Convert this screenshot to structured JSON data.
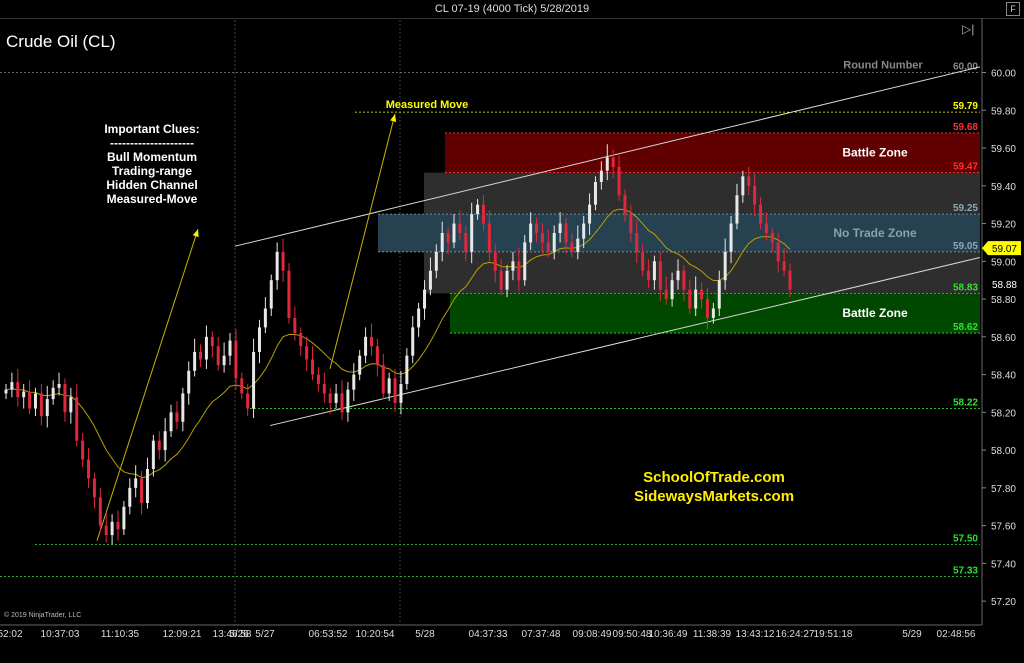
{
  "window": {
    "title": "CL 07-19 (4000 Tick)  5/28/2019",
    "f_button": "F"
  },
  "instrument": "Crude Oil (CL)",
  "clues": {
    "title": "Important Clues:",
    "divider": "---------------------",
    "items": [
      "Bull Momentum",
      "Trading-range",
      "Hidden Channel",
      "Measured-Move"
    ]
  },
  "sites": [
    "SchoolOfTrade.com",
    "SidewaysMarkets.com"
  ],
  "copyright": "© 2019 NinjaTrader, LLC",
  "colors": {
    "up_candle": "#e8e8e8",
    "down_candle": "#e0283c",
    "moving_average": "#b8a000",
    "price_tag": "#ffff00",
    "battle_zone_top": "#6b0000",
    "battle_zone_bottom": "#005000",
    "no_trade_zone": "#2a4858",
    "range_box": "#2e2e2e"
  },
  "chart_data": {
    "type": "candlestick",
    "y_axis": {
      "ticks": [
        "60.00",
        "59.80",
        "59.60",
        "59.40",
        "59.20",
        "59.00",
        "58.80",
        "58.60",
        "58.40",
        "58.20",
        "58.00",
        "57.80",
        "57.60",
        "57.40",
        "57.20"
      ],
      "range": [
        57.1,
        60.2
      ]
    },
    "x_ticks": [
      "52:02",
      "10:37:03",
      "11:10:35",
      "12:09:21",
      "13:46:58",
      "5/26",
      "5/27",
      "06:53:52",
      "10:20:54",
      "5/28",
      "04:37:33",
      "07:37:48",
      "09:08:49",
      "09:50:48",
      "10:36:49",
      "11:38:39",
      "13:43:12",
      "16:24:27",
      "19:51:18",
      "5/29",
      "02:48:56"
    ],
    "current_price": "59.07",
    "last_close": "58.88",
    "levels": [
      {
        "price": 60.0,
        "label": "60.00",
        "color": "#888888",
        "text": "Round Number"
      },
      {
        "price": 59.79,
        "label": "59.79",
        "color": "#ffff00",
        "text": "Measured Move"
      },
      {
        "price": 59.68,
        "label": "59.68",
        "color": "#ff3030"
      },
      {
        "price": 59.47,
        "label": "59.47",
        "color": "#ff3030"
      },
      {
        "price": 59.25,
        "label": "59.25",
        "color": "#8aa8b8"
      },
      {
        "price": 59.05,
        "label": "59.05",
        "color": "#8aa8b8"
      },
      {
        "price": 58.83,
        "label": "58.83",
        "color": "#30e030"
      },
      {
        "price": 58.62,
        "label": "58.62",
        "color": "#30e030"
      },
      {
        "price": 58.22,
        "label": "58.22",
        "color": "#30e030"
      },
      {
        "price": 57.5,
        "label": "57.50",
        "color": "#30e030"
      },
      {
        "price": 57.33,
        "label": "57.33",
        "color": "#30e030"
      }
    ],
    "zones": [
      {
        "name": "Battle Zone",
        "top": 59.68,
        "bottom": 59.47,
        "color": "#6b0000"
      },
      {
        "name": "No Trade Zone",
        "top": 59.25,
        "bottom": 59.05,
        "color": "#2a4858"
      },
      {
        "name": "Battle Zone",
        "top": 58.83,
        "bottom": 58.62,
        "color": "#005000"
      }
    ],
    "closes": [
      58.32,
      58.36,
      58.28,
      58.31,
      58.22,
      58.3,
      58.18,
      58.27,
      58.33,
      58.35,
      58.2,
      58.28,
      58.05,
      57.95,
      57.85,
      57.75,
      57.6,
      57.55,
      57.62,
      57.58,
      57.7,
      57.8,
      57.85,
      57.72,
      57.9,
      58.05,
      58.0,
      58.1,
      58.2,
      58.15,
      58.3,
      58.42,
      58.52,
      58.48,
      58.6,
      58.55,
      58.45,
      58.5,
      58.58,
      58.38,
      58.3,
      58.22,
      58.52,
      58.65,
      58.75,
      58.9,
      59.05,
      58.95,
      58.7,
      58.62,
      58.55,
      58.48,
      58.4,
      58.35,
      58.3,
      58.25,
      58.3,
      58.2,
      58.32,
      58.4,
      58.5,
      58.6,
      58.55,
      58.45,
      58.3,
      58.38,
      58.25,
      58.35,
      58.5,
      58.65,
      58.75,
      58.85,
      58.95,
      59.05,
      59.15,
      59.1,
      59.2,
      59.15,
      59.05,
      59.25,
      59.3,
      59.2,
      59.05,
      58.95,
      58.85,
      58.95,
      59.0,
      58.9,
      59.1,
      59.2,
      59.15,
      59.1,
      59.05,
      59.15,
      59.2,
      59.1,
      59.05,
      59.12,
      59.2,
      59.3,
      59.42,
      59.48,
      59.55,
      59.5,
      59.35,
      59.25,
      59.15,
      59.05,
      58.95,
      58.9,
      59.0,
      58.85,
      58.8,
      58.9,
      58.95,
      58.85,
      58.75,
      58.85,
      58.8,
      58.7,
      58.75,
      58.9,
      59.05,
      59.2,
      59.35,
      59.45,
      59.4,
      59.3,
      59.2,
      59.15,
      59.1,
      59.0,
      58.95,
      58.85
    ]
  }
}
